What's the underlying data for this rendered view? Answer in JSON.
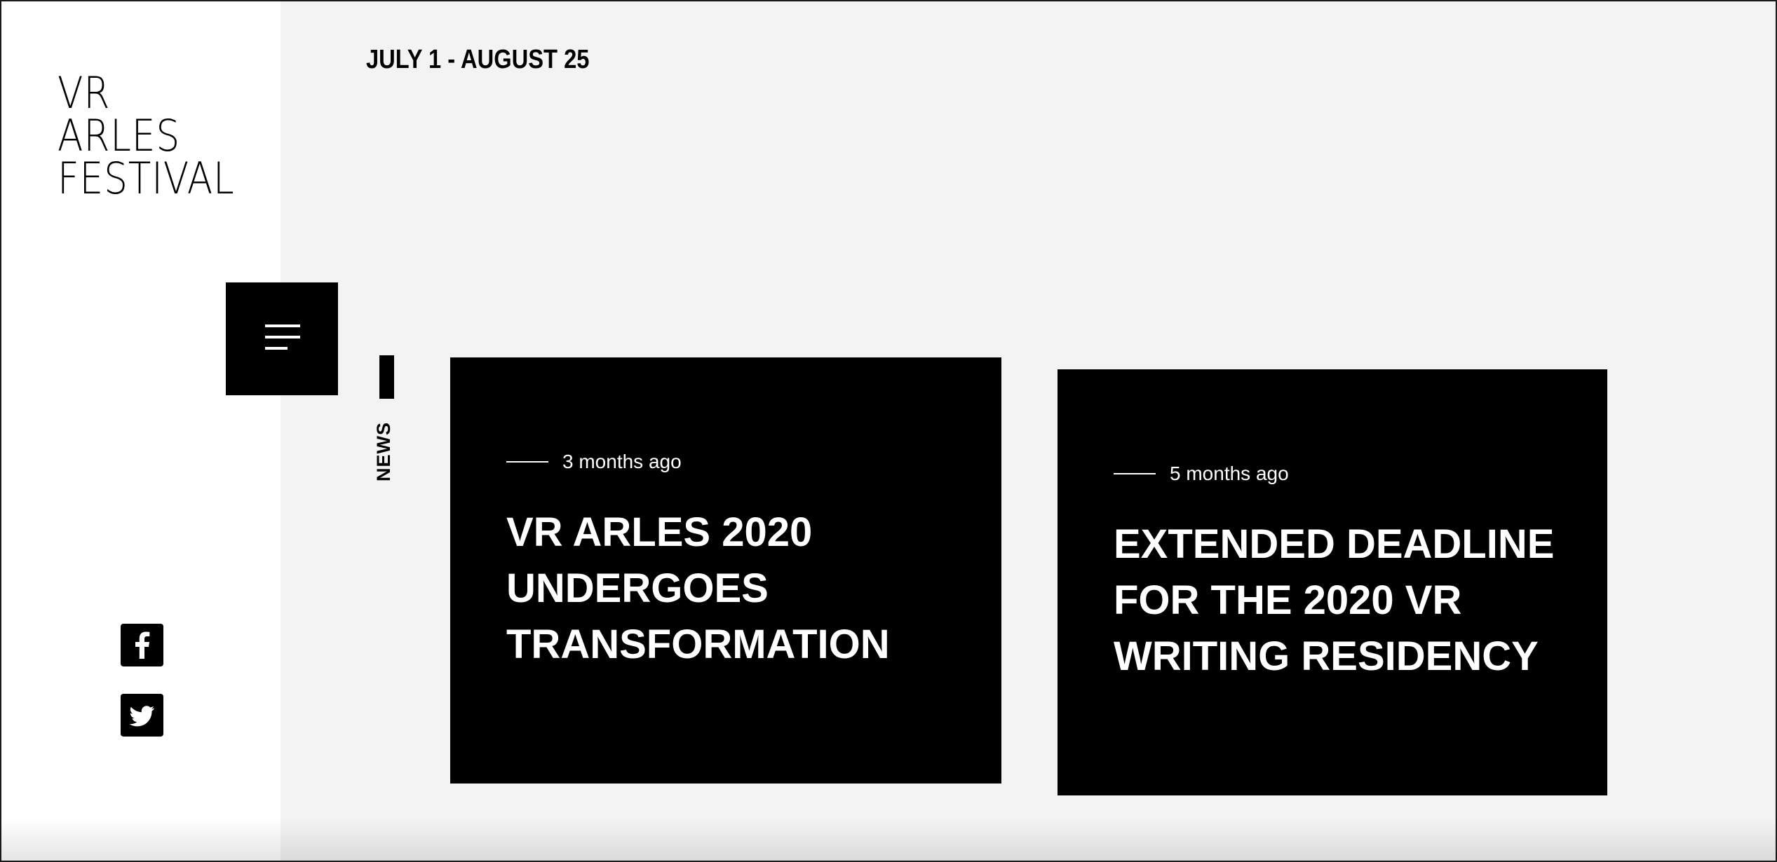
{
  "sidebar": {
    "logo": {
      "line1": "VR",
      "line2": "ARLES",
      "line3": "FESTIVAL"
    },
    "menu_icon": "hamburger-menu-icon",
    "social": [
      {
        "name": "facebook",
        "icon": "facebook-icon"
      },
      {
        "name": "twitter",
        "icon": "twitter-icon"
      }
    ]
  },
  "header": {
    "dates": "JULY 1 - AUGUST 25"
  },
  "news": {
    "label": "NEWS",
    "cards": [
      {
        "time": "3 months ago",
        "title_lines": [
          "VR ARLES 2020",
          "UNDERGOES",
          "TRANSFORMATION"
        ]
      },
      {
        "time": "5 months ago",
        "title_lines": [
          "EXTENDED DEADLINE",
          "FOR THE 2020 VR",
          "WRITING RESIDENCY"
        ]
      }
    ]
  },
  "colors": {
    "sidebar_bg": "#ffffff",
    "main_bg": "#f3f3f3",
    "card_bg": "#000000",
    "text_on_card": "#ffffff"
  }
}
